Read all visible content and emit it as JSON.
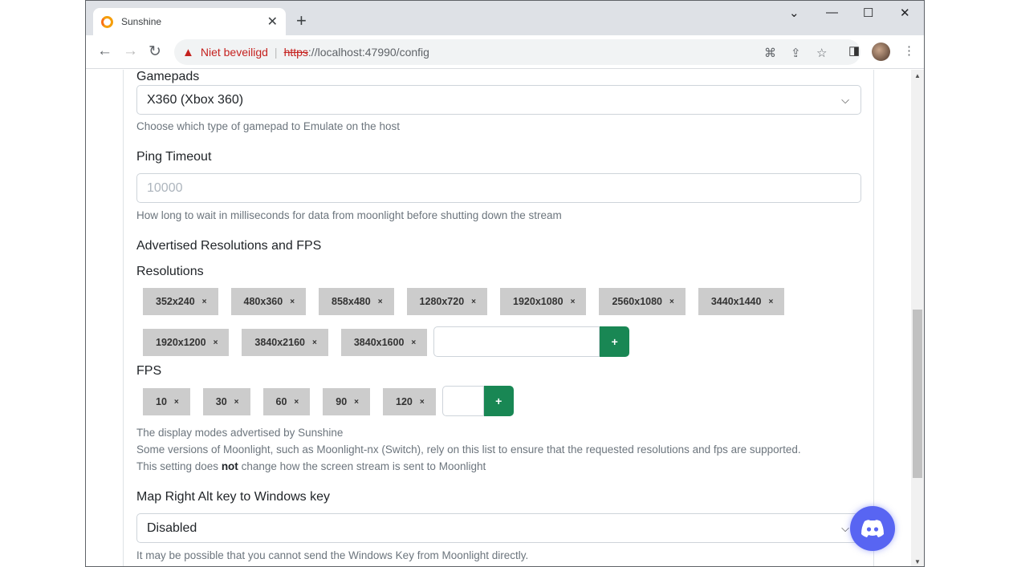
{
  "browser": {
    "tab_title": "Sunshine",
    "security_label": "Niet beveiligd",
    "url_scheme": "https",
    "url_host": "://localhost",
    "url_rest": ":47990/config"
  },
  "form": {
    "gamepads": {
      "label": "Gamepads",
      "value": "X360 (Xbox 360)",
      "help": "Choose which type of gamepad to Emulate on the host"
    },
    "ping": {
      "label": "Ping Timeout",
      "placeholder": "10000",
      "help": "How long to wait in milliseconds for data from moonlight before shutting down the stream"
    },
    "advertised": {
      "title": "Advertised Resolutions and FPS",
      "resolutions_label": "Resolutions",
      "resolutions": [
        "352x240",
        "480x360",
        "858x480",
        "1280x720",
        "1920x1080",
        "2560x1080",
        "3440x1440",
        "1920x1200",
        "3840x2160",
        "3840x1600"
      ],
      "fps_label": "FPS",
      "fps": [
        "10",
        "30",
        "60",
        "90",
        "120"
      ],
      "add_label": "+",
      "remove_label": "×",
      "help1": "The display modes advertised by Sunshine",
      "help2": "Some versions of Moonlight, such as Moonlight-nx (Switch), rely on this list to ensure that the requested resolutions and fps are supported.",
      "help3_a": "This setting does ",
      "help3_b": "not",
      "help3_c": " change how the screen stream is sent to Moonlight"
    },
    "altkey": {
      "label": "Map Right Alt key to Windows key",
      "value": "Disabled",
      "help": "It may be possible that you cannot send the Windows Key from Moonlight directly."
    }
  }
}
